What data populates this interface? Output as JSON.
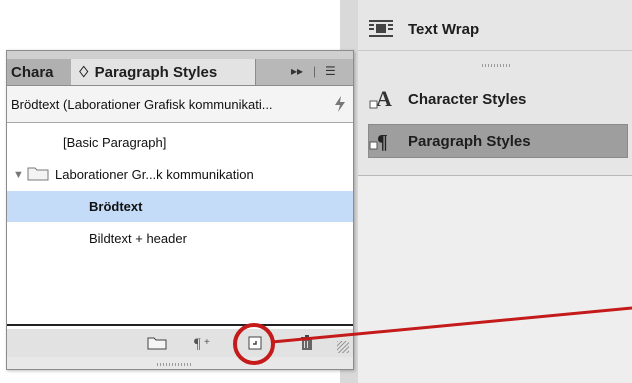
{
  "dock": {
    "items": [
      {
        "label": "Text Wrap",
        "icon": "text-wrap-icon"
      },
      {
        "label": "Character Styles",
        "icon": "character-styles-icon"
      },
      {
        "label": "Paragraph Styles",
        "icon": "paragraph-styles-icon",
        "selected": true
      }
    ]
  },
  "panel": {
    "tabs": [
      {
        "label": "Chara",
        "active": false
      },
      {
        "label": "♢ Paragraph Styles",
        "active": true
      }
    ],
    "tab_controls": {
      "collapse": "▸▸",
      "menu": "☰"
    },
    "current_style": "Brödtext (Laborationer Grafisk kommunikati...",
    "list": [
      {
        "label": "[Basic Paragraph]",
        "indent": 1
      },
      {
        "label": "Laborationer Gr...k kommunikation",
        "indent": 0,
        "folder": true
      },
      {
        "label": "Brödtext",
        "indent": 2,
        "selected": true
      },
      {
        "label": "Bildtext + header",
        "indent": 2
      }
    ],
    "bottom_icons": [
      "new-group-icon",
      "clear-overrides-icon",
      "create-new-style-icon",
      "delete-icon"
    ]
  },
  "colors": {
    "selection": "#c4dcf7",
    "callout": "#c41a1a"
  }
}
